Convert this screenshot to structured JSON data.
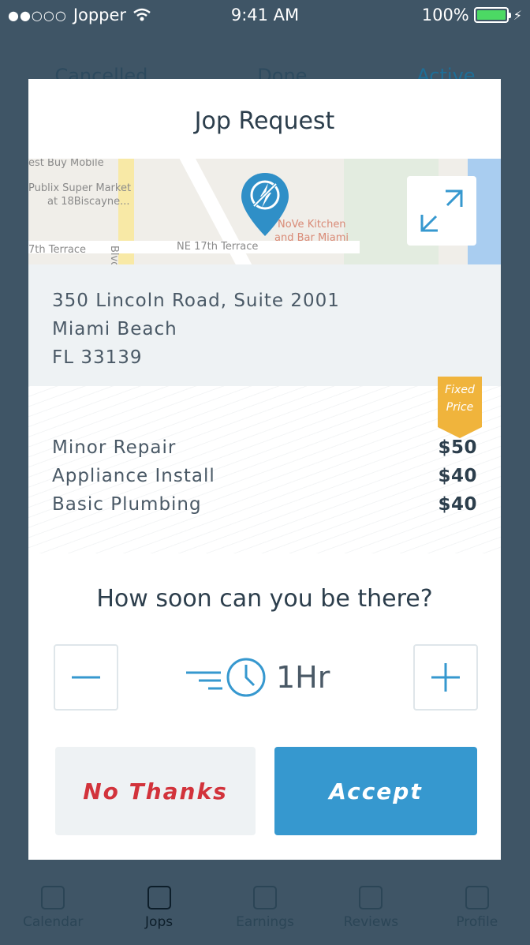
{
  "status_bar": {
    "signal": "●●○○○",
    "carrier": "Jopper",
    "time": "9:41 AM",
    "battery": "100%"
  },
  "background_tabs": [
    "Cancelled",
    "Done",
    "Active"
  ],
  "tab_bar": [
    {
      "label": "Calendar",
      "icon": "calendar-icon"
    },
    {
      "label": "Jops",
      "icon": "briefcase-icon"
    },
    {
      "label": "Earnings",
      "icon": "dollar-icon"
    },
    {
      "label": "Reviews",
      "icon": "star-icon"
    },
    {
      "label": "Profile",
      "icon": "profile-icon"
    }
  ],
  "modal": {
    "title": "Jop Request",
    "map": {
      "labels": [
        "est Buy Mobile",
        "Publix Super Market",
        "at 18Biscayne...",
        "7th Terrace",
        "Blvd",
        "NE 17th Terrace",
        "NoVe Kitchen",
        "and Bar Miami"
      ],
      "pin_icon": "lightning-pin-icon",
      "expand_icon": "expand-icon"
    },
    "address": {
      "line1": "350 Lincoln Road, Suite 2001",
      "line2": "Miami Beach",
      "line3": "FL 33139"
    },
    "badge": {
      "line1": "Fixed",
      "line2": "Price"
    },
    "services": [
      {
        "name": "Minor Repair",
        "price": "$50"
      },
      {
        "name": "Appliance Install",
        "price": "$40"
      },
      {
        "name": "Basic Plumbing",
        "price": "$40"
      }
    ],
    "question": "How soon can you be there?",
    "time_value": "1Hr",
    "decline_label": "No Thanks",
    "accept_label": "Accept"
  },
  "colors": {
    "overlay": "#3f5566",
    "accent": "#3698cf",
    "decline": "#d2333b",
    "badge": "#f0b43c"
  }
}
